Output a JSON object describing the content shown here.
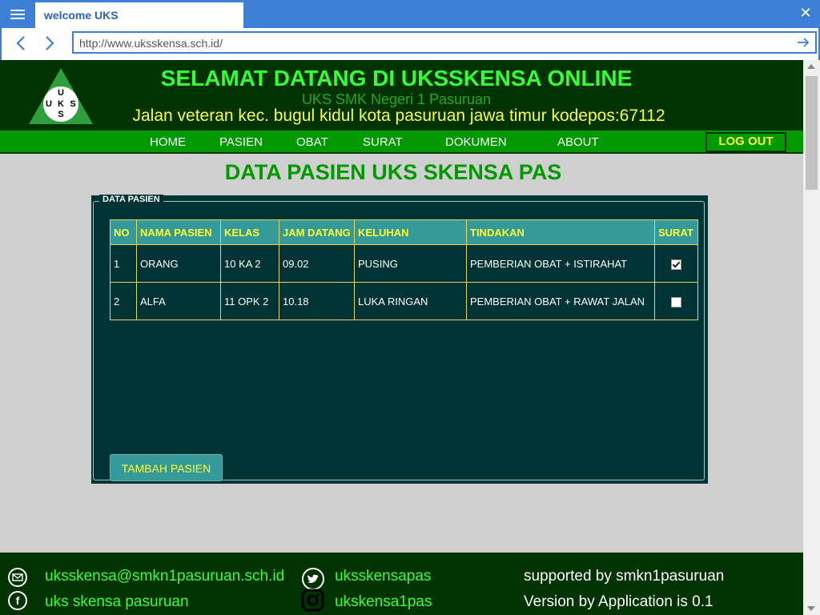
{
  "browser": {
    "tab_title": "welcome UKS",
    "url": "http://www.uksskensa.sch.id/",
    "accent_color": "#3d7fd6"
  },
  "header": {
    "logo_letters": {
      "top": "U",
      "left": "U",
      "center": "K",
      "right": "S",
      "bottom": "S"
    },
    "title": "SELAMAT DATANG DI UKSSKENSA ONLINE",
    "subtitle": "UKS SMK Negeri 1 Pasuruan",
    "address": "Jalan veteran kec. bugul kidul kota pasuruan jawa timur kodepos:67112"
  },
  "nav": {
    "items": [
      "HOME",
      "PASIEN",
      "OBAT",
      "SURAT",
      "DOKUMEN",
      "ABOUT"
    ],
    "logout": "LOG OUT"
  },
  "main": {
    "page_title": "DATA PASIEN UKS SKENSA PAS",
    "panel_legend": "DATA PASIEN",
    "table": {
      "columns": [
        "NO",
        "NAMA PASIEN",
        "KELAS",
        "JAM DATANG",
        "KELUHAN",
        "TINDAKAN",
        "SURAT"
      ],
      "rows": [
        {
          "no": "1",
          "nama": "ORANG",
          "kelas": "10 KA 2",
          "jam": "09.02",
          "keluhan": "PUSING",
          "tindakan": "PEMBERIAN OBAT + ISTIRAHAT",
          "surat_checked": true
        },
        {
          "no": "2",
          "nama": "ALFA",
          "kelas": "11 OPK 2",
          "jam": "10.18",
          "keluhan": "LUKA RINGAN",
          "tindakan": "PEMBERIAN OBAT + RAWAT JALAN",
          "surat_checked": false
        }
      ]
    },
    "add_button": "TAMBAH PASIEN"
  },
  "footer": {
    "email": "uksskensa@smkn1pasuruan.sch.id",
    "facebook": "uks skensa pasuruan",
    "twitter": "uksskensapas",
    "instagram": "ukskensa1pas",
    "supported": "supported by smkn1pasuruan",
    "version": "Version by Application is 0.1"
  },
  "colors": {
    "header_bg": "#003300",
    "title_green": "#33ff33",
    "nav_green": "#009900",
    "accent_yellow": "#ffff33",
    "panel_bg": "#003333",
    "table_header_bg": "#339999"
  }
}
